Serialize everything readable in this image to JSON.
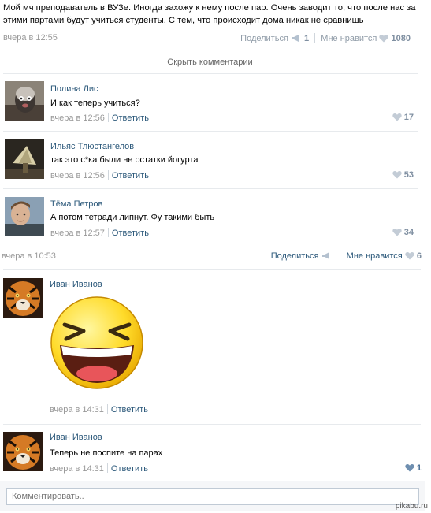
{
  "post": {
    "text": "Мой мч преподаватель в ВУЗе. Иногда захожу к нему после пар. Очень заводит то, что после нас за этими партами будут учиться студенты. С тем, что происходит дома никак не сравнишь",
    "time": "вчера в 12:55",
    "share_label": "Поделиться",
    "share_count": "1",
    "like_label": "Мне нравится",
    "like_count": "1080"
  },
  "hide_comments_label": "Скрыть комментарии",
  "comments": [
    {
      "author": "Полина Лис",
      "text": "И как теперь учиться?",
      "time": "вчера в 12:56",
      "reply": "Ответить",
      "likes": "17"
    },
    {
      "author": "Ильяс Тлюстангелов",
      "text": "так это с*ка были не остатки йогурта",
      "time": "вчера в 12:56",
      "reply": "Ответить",
      "likes": "53"
    },
    {
      "author": "Тёма Петров",
      "text": "А потом тетради липнут. Фу такими быть",
      "time": "вчера в 12:57",
      "reply": "Ответить",
      "likes": "34"
    }
  ],
  "second_post": {
    "time": "вчера в 10:53",
    "share_label": "Поделиться",
    "like_label": "Мне нравится",
    "like_count": "6"
  },
  "third_comments": [
    {
      "author": "Иван Иванов",
      "time": "вчера в 14:31",
      "reply": "Ответить"
    },
    {
      "author": "Иван Иванов",
      "text": "Теперь не поспите на парах",
      "time": "вчера в 14:31",
      "reply": "Ответить",
      "likes": "1"
    }
  ],
  "comment_input": {
    "placeholder": "Комментировать.."
  },
  "watermark": "pikabu.ru",
  "icons": {
    "heart": "heart-icon",
    "share": "megaphone-icon"
  }
}
